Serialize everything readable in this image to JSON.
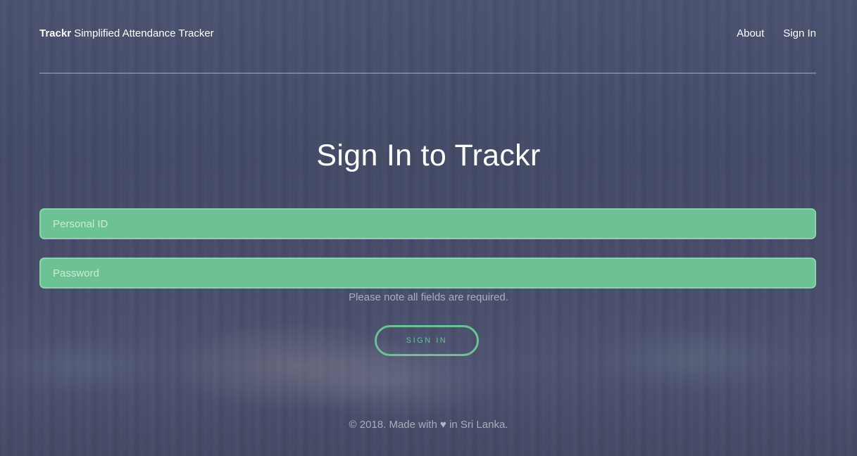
{
  "header": {
    "brand_name": "Trackr",
    "brand_tagline": "Simplified Attendance Tracker",
    "nav": [
      {
        "label": "About"
      },
      {
        "label": "Sign In"
      }
    ]
  },
  "main": {
    "title": "Sign In to Trackr",
    "personal_id": {
      "placeholder": "Personal ID",
      "value": ""
    },
    "password": {
      "placeholder": "Password",
      "value": ""
    },
    "note": "Please note all fields are required.",
    "submit_label": "SIGN IN"
  },
  "footer": {
    "prefix": "© 2018. Made with",
    "heart_icon": "heart-icon",
    "suffix": "in Sri Lanka."
  },
  "colors": {
    "accent": "#6cc292",
    "background": "#454c66"
  }
}
